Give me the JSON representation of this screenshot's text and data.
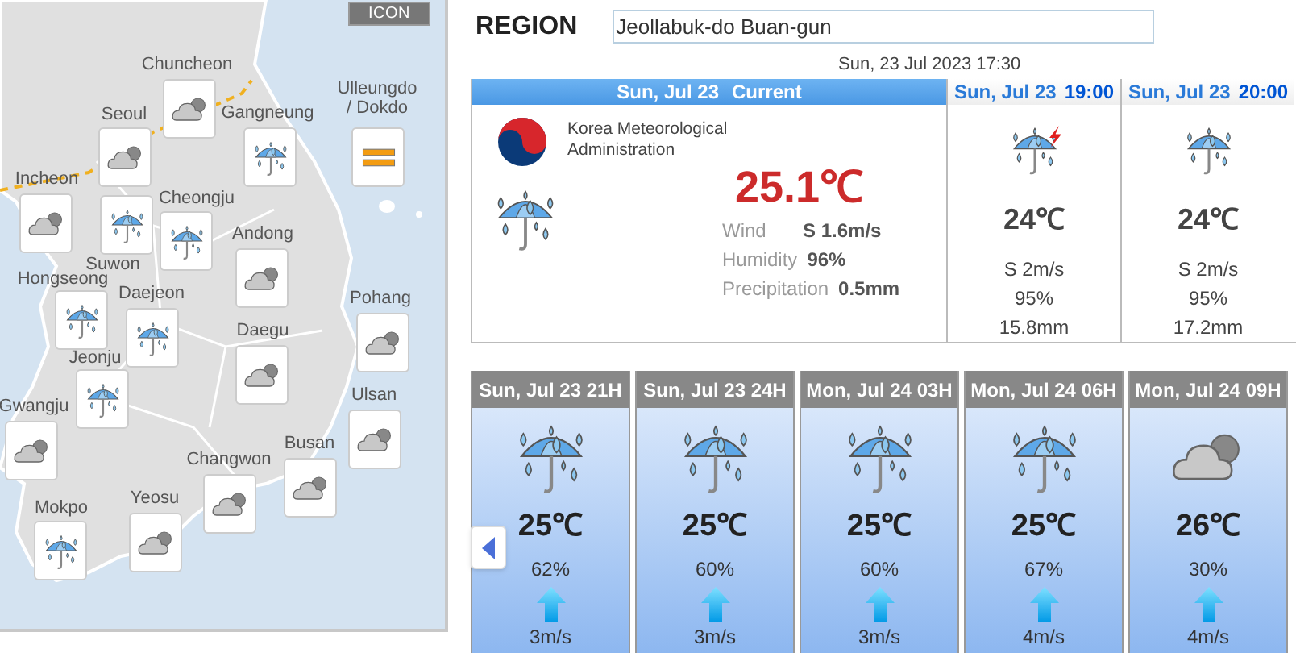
{
  "map": {
    "button": "ICON",
    "cities": [
      {
        "name": "Chuncheon",
        "kind": "cloudy"
      },
      {
        "name": "Seoul",
        "kind": "cloudy"
      },
      {
        "name": "Gangneung",
        "kind": "rain"
      },
      {
        "name": "Ulleungdo / Dokdo",
        "kind": "haze"
      },
      {
        "name": "Incheon",
        "kind": "cloudy"
      },
      {
        "name": "Suwon",
        "kind": "rain"
      },
      {
        "name": "Cheongju",
        "kind": "rain"
      },
      {
        "name": "Andong",
        "kind": "cloudy"
      },
      {
        "name": "Hongseong",
        "kind": "rain"
      },
      {
        "name": "Daejeon",
        "kind": "rain"
      },
      {
        "name": "Pohang",
        "kind": "cloudy"
      },
      {
        "name": "Daegu",
        "kind": "cloudy"
      },
      {
        "name": "Jeonju",
        "kind": "rain"
      },
      {
        "name": "Gwangju",
        "kind": "cloudy"
      },
      {
        "name": "Ulsan",
        "kind": "cloudy"
      },
      {
        "name": "Busan",
        "kind": "cloudy"
      },
      {
        "name": "Changwon",
        "kind": "cloudy"
      },
      {
        "name": "Yeosu",
        "kind": "cloudy"
      },
      {
        "name": "Mokpo",
        "kind": "rain"
      }
    ]
  },
  "region": {
    "label": "REGION",
    "value": "Jeollabuk-do Buan-gun"
  },
  "updated": "Sun, 23 Jul 2023 17:30",
  "current": {
    "date": "Sun, Jul 23",
    "label": "Current",
    "agency": "Korea Meteorological Administration",
    "kind": "rain",
    "temperature": "25.1℃",
    "details": [
      {
        "label": "Wind",
        "value": "S 1.6m/s"
      },
      {
        "label": "Humidity",
        "value": "96%"
      },
      {
        "label": "Precipitation",
        "value": "0.5mm"
      }
    ]
  },
  "hourly": [
    {
      "date": "Sun, Jul 23",
      "time": "19:00",
      "kind": "thunder",
      "temperature": "24℃",
      "wind": "S 2m/s",
      "humidity": "95%",
      "precipitation": "15.8mm"
    },
    {
      "date": "Sun, Jul 23",
      "time": "20:00",
      "kind": "rain",
      "temperature": "24℃",
      "wind": "S 2m/s",
      "humidity": "95%",
      "precipitation": "17.2mm"
    }
  ],
  "forecast": [
    {
      "title": "Sun, Jul 23 21H",
      "kind": "rain",
      "temperature": "25℃",
      "chance": "62%",
      "wind": "3m/s"
    },
    {
      "title": "Sun, Jul 23 24H",
      "kind": "rain",
      "temperature": "25℃",
      "chance": "60%",
      "wind": "3m/s"
    },
    {
      "title": "Mon, Jul 24 03H",
      "kind": "rain",
      "temperature": "25℃",
      "chance": "60%",
      "wind": "3m/s"
    },
    {
      "title": "Mon, Jul 24 06H",
      "kind": "rain",
      "temperature": "25℃",
      "chance": "67%",
      "wind": "4m/s"
    },
    {
      "title": "Mon, Jul 24 09H",
      "kind": "cloudy",
      "temperature": "26℃",
      "chance": "30%",
      "wind": "4m/s"
    }
  ]
}
